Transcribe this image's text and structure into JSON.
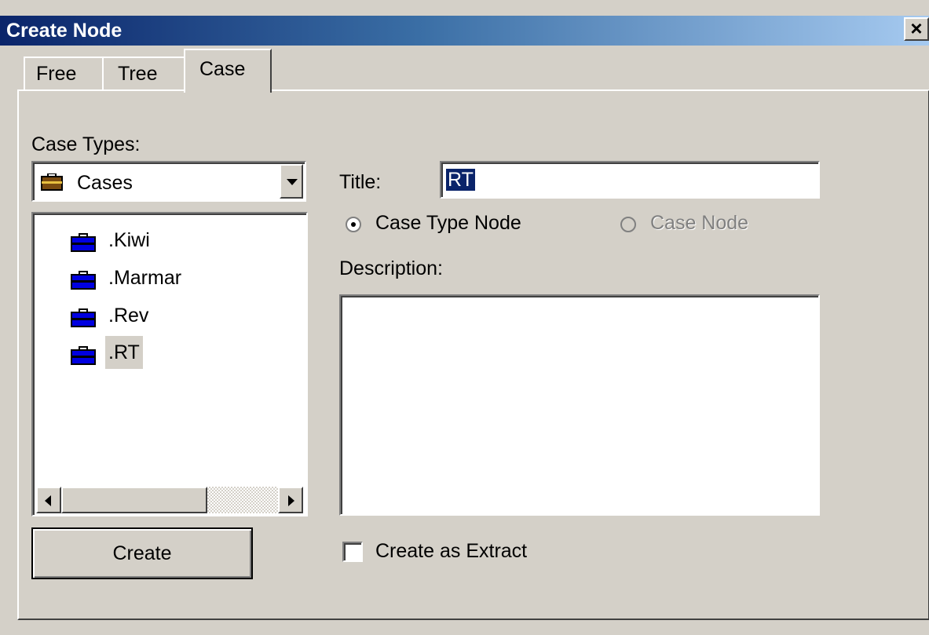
{
  "window": {
    "title": "Create Node",
    "close_label": "×"
  },
  "tabs": [
    {
      "label": "Free"
    },
    {
      "label": "Tree"
    },
    {
      "label": "Case",
      "active": true
    }
  ],
  "case_types": {
    "label": "Case Types:",
    "selected": "Cases",
    "selected_icon": "briefcase-icon",
    "items": [
      {
        "label": ".Kiwi",
        "icon": "briefcase-icon"
      },
      {
        "label": ".Marmar",
        "icon": "briefcase-icon"
      },
      {
        "label": ".Rev",
        "icon": "briefcase-icon"
      },
      {
        "label": ".RT",
        "icon": "briefcase-icon",
        "selected": true
      }
    ]
  },
  "form": {
    "title_label": "Title:",
    "title_value": "RT",
    "radio_case_type_node": "Case Type Node",
    "radio_case_node": "Case Node",
    "description_label": "Description:",
    "description_value": "",
    "create_as_extract_label": "Create as Extract",
    "create_button": "Create"
  },
  "colors": {
    "dialog_bg": "#d4d0c8",
    "titlebar_start": "#0a246a",
    "titlebar_end": "#a6caf0",
    "briefcase_blue": "#0000e0",
    "briefcase_brown": "#7a4a10",
    "selection": "#0a246a"
  }
}
